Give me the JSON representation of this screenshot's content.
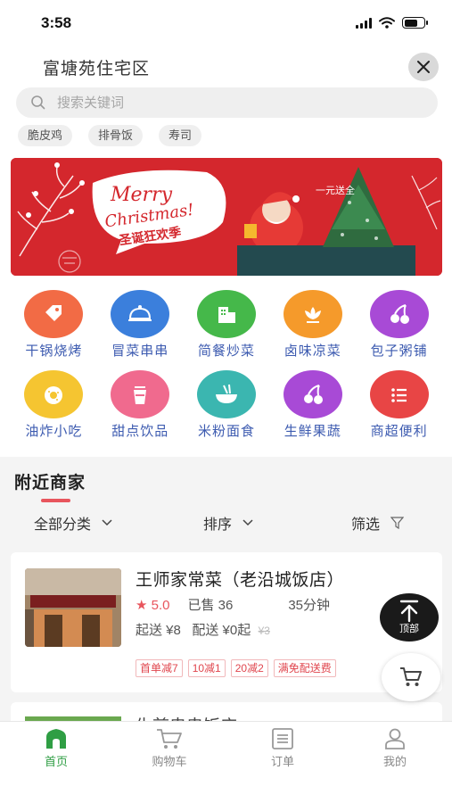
{
  "status_bar": {
    "time": "3:58"
  },
  "header": {
    "location": "富塘苑住宅区",
    "search_placeholder": "搜索关键词",
    "hot_tags": [
      "脆皮鸡",
      "排骨饭",
      "寿司"
    ]
  },
  "banner": {
    "title_line1": "Merry",
    "title_line2": "Christmas!",
    "subtitle": "圣诞狂欢季",
    "side_text": "一元送全"
  },
  "categories": [
    {
      "label": "干锅烧烤",
      "icon": "tag-icon",
      "color": "#f26b45"
    },
    {
      "label": "冒菜串串",
      "icon": "dish-cover-icon",
      "color": "#3b7fdc"
    },
    {
      "label": "简餐炒菜",
      "icon": "building-icon",
      "color": "#45b84a"
    },
    {
      "label": "卤味凉菜",
      "icon": "lotus-icon",
      "color": "#f59a2b"
    },
    {
      "label": "包子粥铺",
      "icon": "cherry-icon",
      "color": "#a84ad6"
    },
    {
      "label": "油炸小吃",
      "icon": "donut-icon",
      "color": "#f5c531"
    },
    {
      "label": "甜点饮品",
      "icon": "cup-icon",
      "color": "#f06a8e"
    },
    {
      "label": "米粉面食",
      "icon": "noodle-bowl-icon",
      "color": "#3bb6b0"
    },
    {
      "label": "生鲜果蔬",
      "icon": "cherry-icon",
      "color": "#a84ad6"
    },
    {
      "label": "商超便利",
      "icon": "list-icon",
      "color": "#e84545"
    }
  ],
  "nearby": {
    "title": "附近商家",
    "filters": {
      "category": "全部分类",
      "sort": "排序",
      "filter": "筛选"
    },
    "shops": [
      {
        "name": "王师家常菜（老沿城饭店）",
        "rating": "★ 5.0",
        "sold": "已售 36",
        "time": "35分钟",
        "min_order": "起送 ¥8",
        "delivery": "配送 ¥0起",
        "original_delivery": "¥3",
        "promos": [
          "首单减7",
          "10减1",
          "20减2",
          "满免配送费"
        ]
      },
      {
        "name": "生煎串串饭店"
      }
    ]
  },
  "floating": {
    "top_label": "顶部"
  },
  "tabbar": {
    "tabs": [
      {
        "label": "首页",
        "active": true
      },
      {
        "label": "购物车",
        "active": false
      },
      {
        "label": "订单",
        "active": false
      },
      {
        "label": "我的",
        "active": false
      }
    ]
  },
  "colors": {
    "accent_green": "#2f9e44",
    "promo_red": "#e0454d",
    "banner_red": "#d4272d"
  }
}
